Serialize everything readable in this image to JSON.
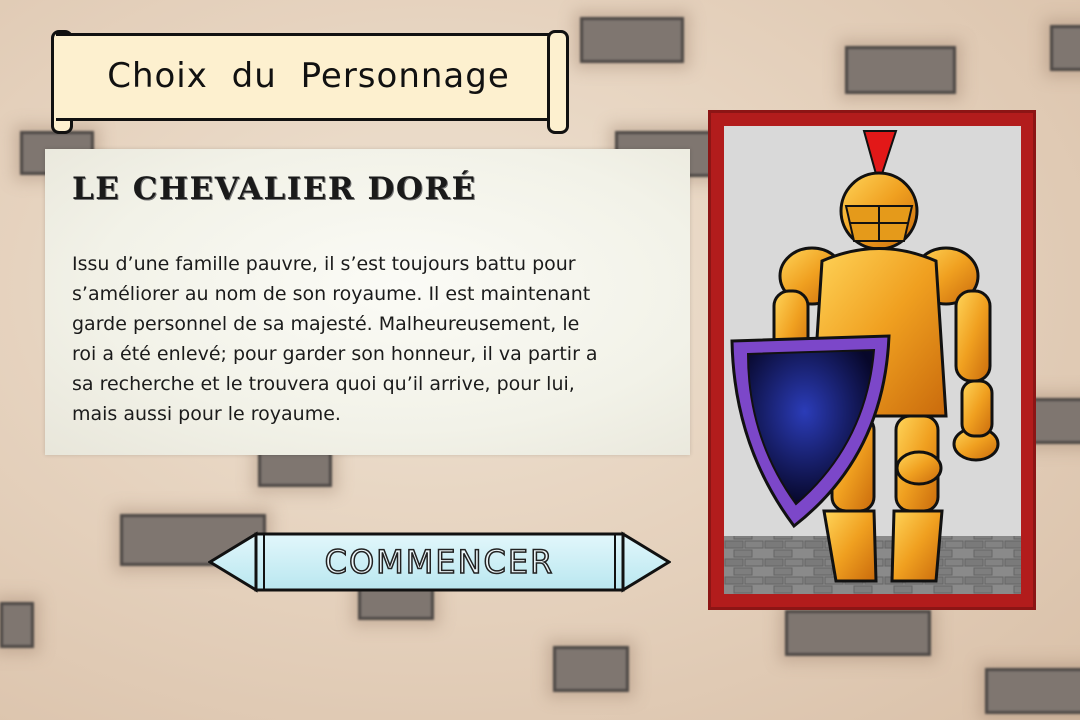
{
  "screen": {
    "title": "Choix du Personnage"
  },
  "character": {
    "name": "LE CHEVALIER DORÉ",
    "description_lines": [
      "Issu d’une famille pauvre, il s’est toujours battu pour",
      "s’améliorer au nom de son royaume. Il est maintenant",
      "garde personnel de sa majesté. Malheureusement, le",
      "roi a été enlevé; pour garder son honneur, il va partir a",
      "sa recherche et le trouvera quoi qu’il arrive, pour lui,",
      "mais aussi pour le royaume."
    ],
    "portrait_icon": "golden-knight-with-shield"
  },
  "actions": {
    "start_label": "COMMENCER",
    "prev_icon": "arrow-left-icon",
    "next_icon": "arrow-right-icon"
  },
  "colors": {
    "frame": "#b21c1c",
    "scroll": "#fdf0cf",
    "button": "#c9eef5",
    "armor": "#e8961a",
    "shield": "#6a3fb0"
  }
}
